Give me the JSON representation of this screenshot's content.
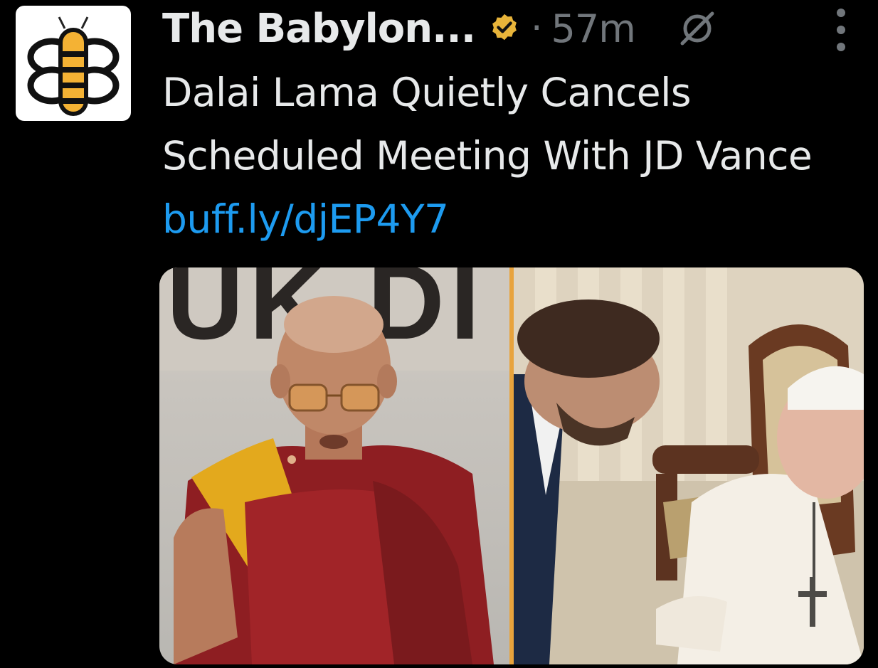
{
  "tweet": {
    "author": {
      "display_name": "The Babylon...",
      "avatar_icon": "babylon-bee-logo",
      "verified_badge_color": "#e8b43a"
    },
    "separator": "·",
    "timestamp": "57m",
    "grok_icon": "grok-icon",
    "more_icon": "more-options-icon",
    "text": "Dalai Lama Quietly Cancels Scheduled Meeting With JD Vance",
    "link": "buff.ly/djEP4Y7",
    "media": {
      "left_sign_text": "UK DI",
      "divider_color": "#e8a33c"
    }
  }
}
